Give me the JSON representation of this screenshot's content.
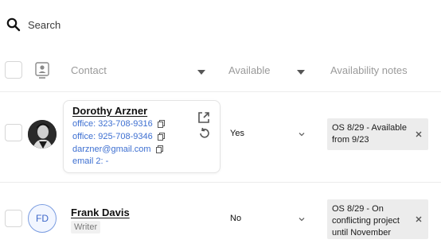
{
  "search": {
    "placeholder": "Search"
  },
  "table": {
    "columns": {
      "contact": "Contact",
      "available": "Available",
      "availability_notes": "Availability notes"
    },
    "rows": [
      {
        "name": "Dorothy Arzner",
        "avatar": "photo",
        "contact_lines": [
          "office: 323-708-9316",
          "office: 925-708-9346",
          "darzner@gmail.com",
          "email 2: -"
        ],
        "available": "Yes",
        "note": "OS 8/29 - Available from 9/23"
      },
      {
        "name": "Frank Davis",
        "initials": "FD",
        "role": "Writer",
        "available": "No",
        "note": "OS 8/29 - On conflicting project until November"
      }
    ]
  },
  "colors": {
    "link_blue": "#3d6fd1",
    "note_bg": "#ececec",
    "initials_ring": "#7a9ce0"
  },
  "icons": [
    "search-icon",
    "contact-card-icon",
    "caret-down-icon",
    "copy-icon",
    "external-link-icon",
    "refresh-icon",
    "chevron-down-icon",
    "close-icon"
  ]
}
